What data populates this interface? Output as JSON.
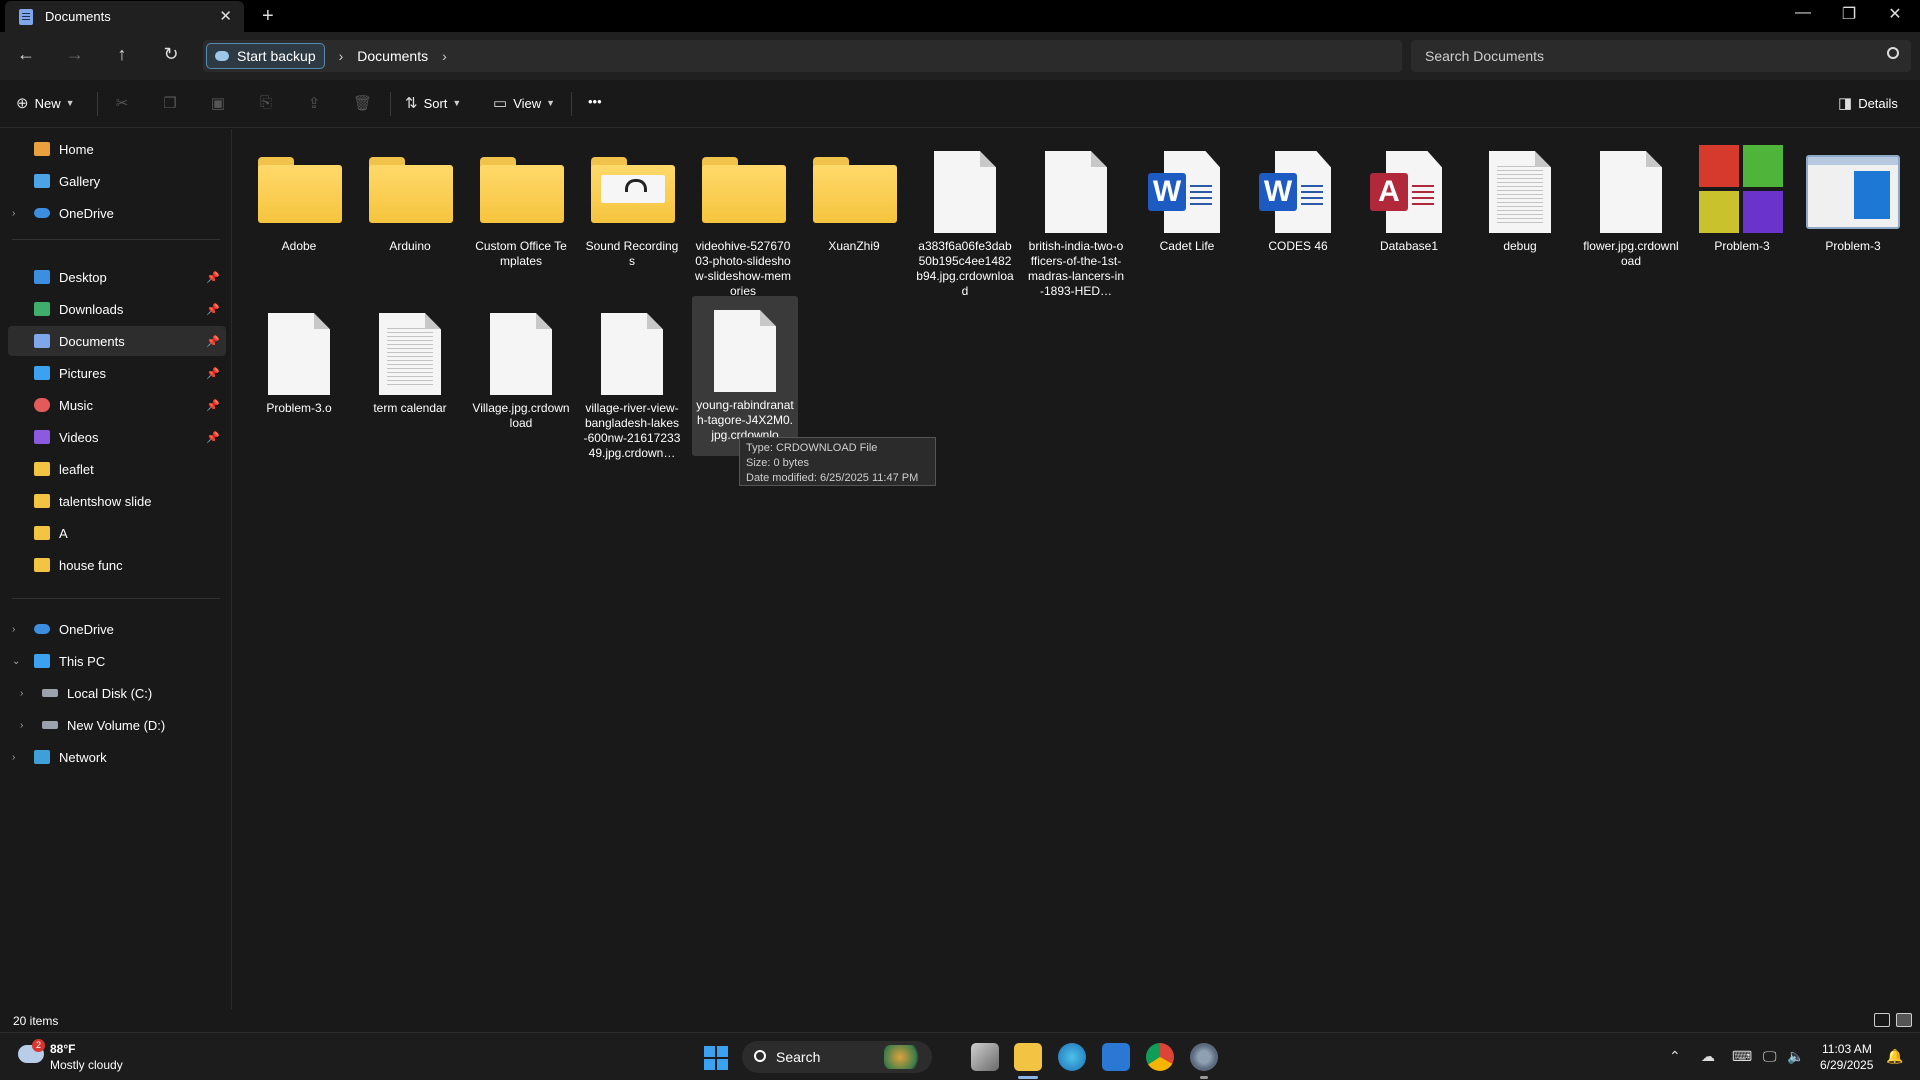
{
  "window": {
    "tab_title": "Documents",
    "new_tab": "+",
    "close_tab": "✕",
    "minimize": "—",
    "maximize": "❐",
    "close": "✕"
  },
  "address": {
    "backup_label": "Start backup",
    "crumbs": [
      "Documents"
    ],
    "search_placeholder": "Search Documents"
  },
  "toolbar": {
    "new_label": "New",
    "sort_label": "Sort",
    "view_label": "View",
    "more_label": "•••",
    "details_label": "Details"
  },
  "sidebar": {
    "quick": [
      {
        "label": "Home",
        "icon": "home-icon",
        "color": "#e8a13c"
      },
      {
        "label": "Gallery",
        "icon": "gallery-icon",
        "color": "#4ca3e8"
      },
      {
        "label": "OneDrive",
        "icon": "cloud-icon",
        "color": "#3b8ee0"
      }
    ],
    "pinned": [
      {
        "label": "Desktop",
        "icon": "desktop-icon",
        "color": "#3b8ee0"
      },
      {
        "label": "Downloads",
        "icon": "download-icon",
        "color": "#3fae6a"
      },
      {
        "label": "Documents",
        "icon": "documents-icon",
        "color": "#7fa6e8"
      },
      {
        "label": "Pictures",
        "icon": "pictures-icon",
        "color": "#3ba2f2"
      },
      {
        "label": "Music",
        "icon": "music-icon",
        "color": "#e25a5a"
      },
      {
        "label": "Videos",
        "icon": "videos-icon",
        "color": "#8a5ae0"
      }
    ],
    "folders": [
      {
        "label": "leaflet"
      },
      {
        "label": "talentshow slide"
      },
      {
        "label": "A"
      },
      {
        "label": "house func"
      }
    ],
    "tree": [
      {
        "label": "OneDrive",
        "icon": "cloud-icon",
        "expander": "›"
      },
      {
        "label": "This PC",
        "icon": "pc-icon",
        "expander": "⌄"
      },
      {
        "label": "Local Disk (C:)",
        "icon": "drive-icon",
        "expander": "›"
      },
      {
        "label": "New Volume (D:)",
        "icon": "drive-icon",
        "expander": "›"
      },
      {
        "label": "Network",
        "icon": "network-icon",
        "expander": "›"
      }
    ]
  },
  "files": [
    {
      "name": "Adobe",
      "type": "folder"
    },
    {
      "name": "Arduino",
      "type": "folder"
    },
    {
      "name": "Custom Office Templates",
      "type": "folder"
    },
    {
      "name": "Sound Recordings",
      "type": "folder-headphones"
    },
    {
      "name": "videohive-52767003-photo-slideshow-slideshow-memories",
      "type": "folder"
    },
    {
      "name": "XuanZhi9",
      "type": "folder"
    },
    {
      "name": "a383f6a06fe3dab50b195c4ee1482b94.jpg.crdownload",
      "type": "file"
    },
    {
      "name": "british-india-two-officers-of-the-1st-madras-lancers-in-1893-HED…",
      "type": "file"
    },
    {
      "name": "Cadet Life",
      "type": "word"
    },
    {
      "name": "CODES 46",
      "type": "word"
    },
    {
      "name": "Database1",
      "type": "access"
    },
    {
      "name": "debug",
      "type": "file-lines"
    },
    {
      "name": "flower.jpg.crdownload",
      "type": "file"
    },
    {
      "name": "Problem-3",
      "type": "tiles"
    },
    {
      "name": "Problem-3",
      "type": "window"
    },
    {
      "name": "Problem-3.o",
      "type": "file"
    },
    {
      "name": "term calendar",
      "type": "file-lines"
    },
    {
      "name": "Village.jpg.crdownload",
      "type": "file"
    },
    {
      "name": "village-river-view-bangladesh-lakes-600nw-2161723349.jpg.crdown…",
      "type": "file"
    },
    {
      "name": "young-rabindranath-tagore-J4X2M0.jpg.crdownlo",
      "type": "file"
    }
  ],
  "tooltip": {
    "line1": "Type: CRDOWNLOAD File",
    "line2": "Size: 0 bytes",
    "line3": "Date modified: 6/25/2025 11:47 PM"
  },
  "status": {
    "items": "20 items"
  },
  "taskbar": {
    "badge": "2",
    "temp": "88°F",
    "weather": "Mostly cloudy",
    "search_label": "Search",
    "time": "11:03 AM",
    "date": "6/29/2025"
  }
}
